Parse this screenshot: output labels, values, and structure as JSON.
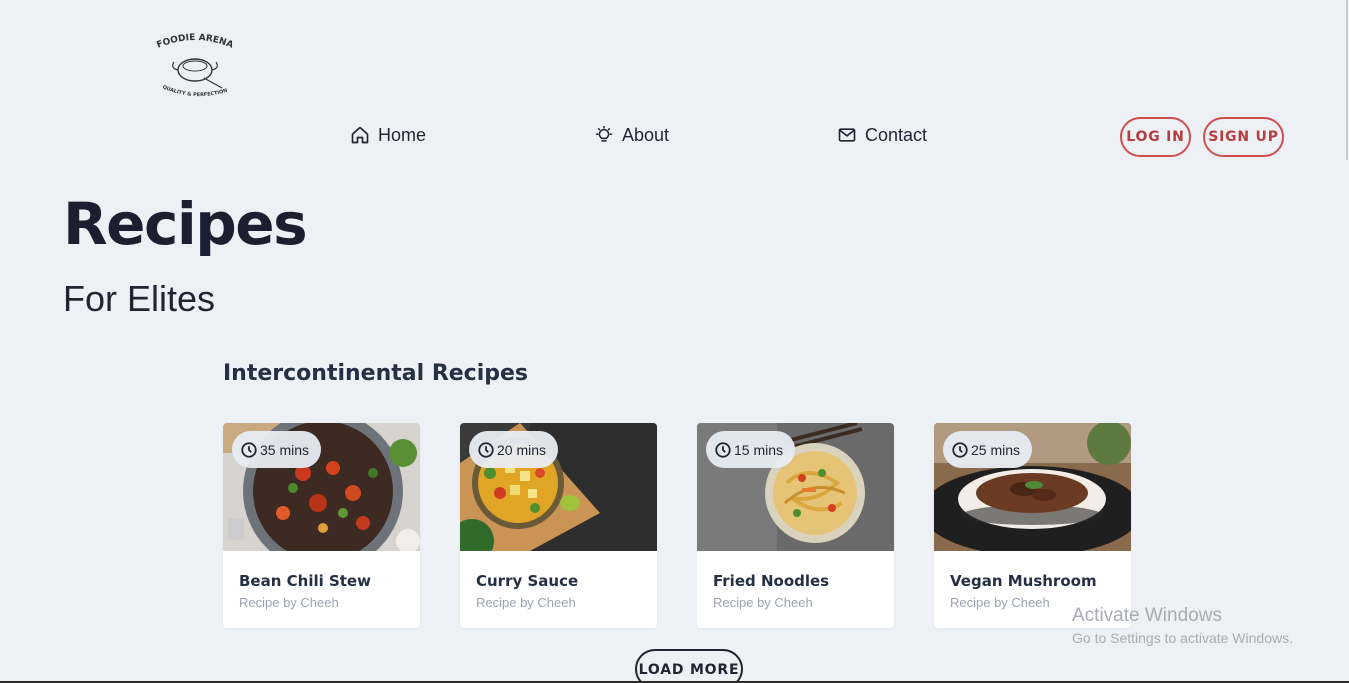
{
  "brand": {
    "name": "FOODIE ARENA",
    "tagline": "QUALITY & PERFECTION"
  },
  "nav": {
    "items": [
      {
        "label": "Home",
        "icon": "home-icon"
      },
      {
        "label": "About",
        "icon": "lightbulb-icon"
      },
      {
        "label": "Contact",
        "icon": "envelope-icon"
      }
    ],
    "login_label": "LOG IN",
    "signup_label": "SIGN UP"
  },
  "hero": {
    "title": "Recipes",
    "subtitle": "For Elites"
  },
  "section": {
    "title": "Intercontinental Recipes"
  },
  "recipes": [
    {
      "time": "35 mins",
      "name": "Bean Chili Stew",
      "author": "Recipe by Cheeh"
    },
    {
      "time": "20 mins",
      "name": "Curry Sauce",
      "author": "Recipe by Cheeh"
    },
    {
      "time": "15 mins",
      "name": "Fried Noodles",
      "author": "Recipe by Cheeh"
    },
    {
      "time": "25 mins",
      "name": "Vegan Mushroom",
      "author": "Recipe by Cheeh"
    }
  ],
  "load_more_label": "LOAD MORE",
  "windows_watermark": {
    "title": "Activate Windows",
    "subtitle": "Go to Settings to activate Windows."
  },
  "colors": {
    "background": "#edf1f6",
    "accent": "#d04e4e",
    "text": "#1f2533"
  }
}
